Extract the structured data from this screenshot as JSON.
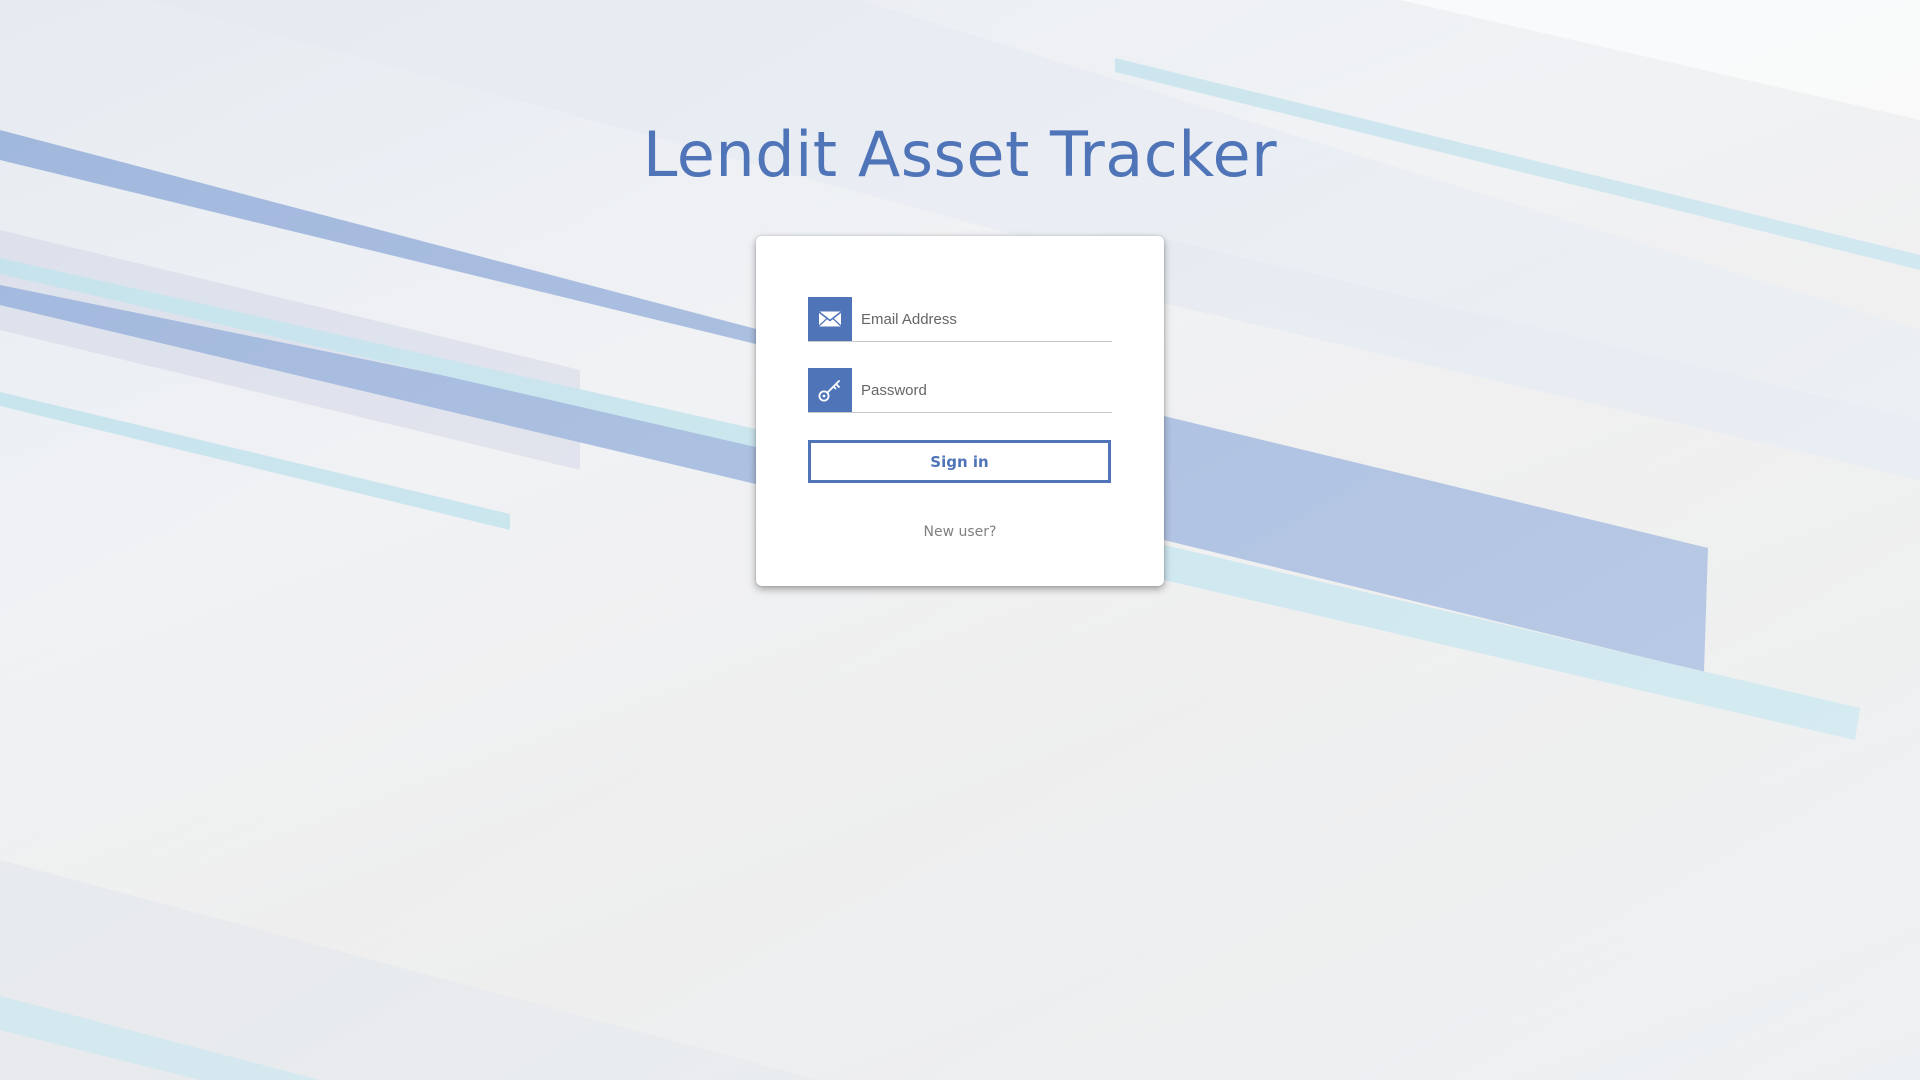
{
  "app": {
    "title": "Lendit Asset Tracker"
  },
  "login_form": {
    "email": {
      "placeholder": "Email Address",
      "value": "",
      "icon": "envelope-icon"
    },
    "password": {
      "placeholder": "Password",
      "value": "",
      "icon": "key-icon"
    },
    "signin_label": "Sign in",
    "new_user_label": "New user?"
  },
  "colors": {
    "accent": "#4f74b8",
    "stripe_blue": "#9fb6dc",
    "stripe_cyan": "#c4e2ec",
    "card_background": "#ffffff"
  }
}
